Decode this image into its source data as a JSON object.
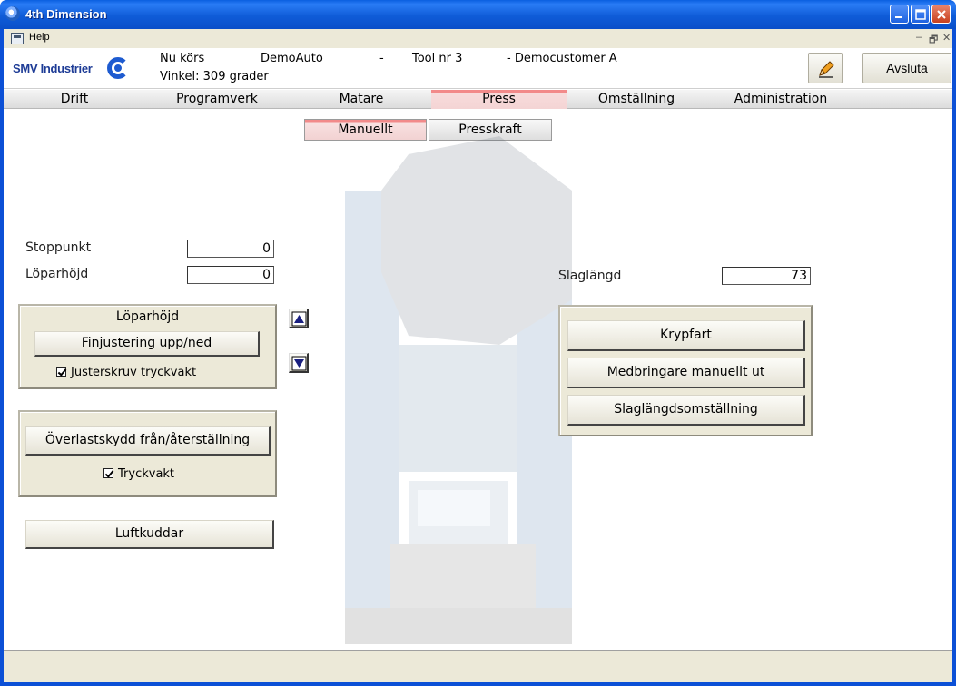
{
  "window": {
    "title": "4th Dimension"
  },
  "menu": {
    "help": "Help",
    "mdi_min": "–",
    "mdi_restore": "🗗",
    "mdi_close": "✕"
  },
  "header": {
    "logo_text": "SMV Industrier",
    "running_label": "Nu körs",
    "program": "DemoAuto",
    "dash1": "-",
    "tool": "Tool nr 3",
    "customer": "- Democustomer A",
    "angle": "Vinkel: 309 grader",
    "exit_button": "Avsluta"
  },
  "tabs": [
    "Drift",
    "Programverk",
    "Matare",
    "Press",
    "Omställning",
    "Administration"
  ],
  "active_tab": "Press",
  "subtabs": [
    "Manuellt",
    "Presskraft"
  ],
  "active_subtab": "Manuellt",
  "fields": {
    "stoppunkt": {
      "label": "Stoppunkt",
      "value": "0"
    },
    "loparhojd": {
      "label": "Löparhöjd",
      "value": "0"
    },
    "slaglangd": {
      "label": "Slaglängd",
      "value": "73"
    }
  },
  "loparhojd_panel": {
    "title": "Löparhöjd",
    "fine_button": "Finjustering upp/ned",
    "checkbox": "Justerskruv tryckvakt",
    "checked": true
  },
  "overload_panel": {
    "button": "Överlastskydd från/återställning",
    "checkbox": "Tryckvakt",
    "checked": true
  },
  "air_button": "Luftkuddar",
  "right_panel": {
    "buttons": [
      "Krypfart",
      "Medbringare manuellt ut",
      "Slaglängdsomställning"
    ]
  },
  "icons": [
    "app-icon",
    "menu-icon",
    "pencil-icon",
    "arrow-up-icon",
    "arrow-down-icon",
    "smv-logo-icon"
  ],
  "colors": {
    "titlebar": "#0f5cd8",
    "active_tab": "#f28a8a",
    "panel": "#ece9d8",
    "logo": "#1e3c96"
  }
}
